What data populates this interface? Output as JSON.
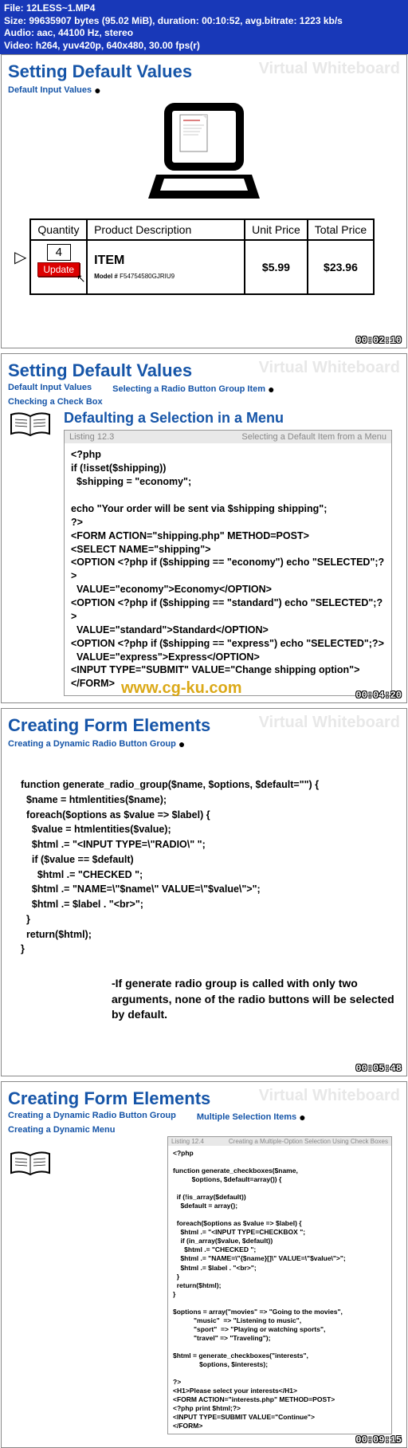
{
  "header": {
    "file": "File: 12LESS~1.MP4",
    "size": "Size: 99635907 bytes (95.02 MiB), duration: 00:10:52, avg.bitrate: 1223 kb/s",
    "audio": "Audio: aac, 44100 Hz, stereo",
    "video": "Video: h264, yuv420p, 640x480, 30.00 fps(r)"
  },
  "slide1": {
    "title": "Setting Default Values",
    "watermark": "Virtual Whiteboard",
    "crumb": "Default Input Values",
    "table": {
      "h1": "Quantity",
      "h2": "Product Description",
      "h3": "Unit Price",
      "h4": "Total Price",
      "qty": "4",
      "update": "Update",
      "item": "ITEM",
      "model": "Model #",
      "modelnum": "F54754580GJRIU9",
      "unit": "$5.99",
      "total": "$23.96"
    },
    "ts": "00:02:10"
  },
  "slide2": {
    "title": "Setting Default Values",
    "watermark": "Virtual Whiteboard",
    "crumb1": "Default Input Values",
    "crumb2": "Selecting a Radio Button Group Item",
    "crumb3": "Checking a Check Box",
    "section": "Defaulting a Selection in a Menu",
    "listing_no": "Listing 12.3",
    "listing_title": "Selecting a Default Item from a Menu",
    "code": "<?php\nif (!isset($shipping))\n  $shipping = \"economy\";\n\necho \"Your order will be sent via $shipping shipping\";\n?>\n<FORM ACTION=\"shipping.php\" METHOD=POST>\n<SELECT NAME=\"shipping\">\n<OPTION <?php if ($shipping == \"economy\") echo \"SELECTED\";?>\n  VALUE=\"economy\">Economy</OPTION>\n<OPTION <?php if ($shipping == \"standard\") echo \"SELECTED\";?>\n  VALUE=\"standard\">Standard</OPTION>\n<OPTION <?php if ($shipping == \"express\") echo \"SELECTED\";?>\n  VALUE=\"express\">Express</OPTION>\n<INPUT TYPE=\"SUBMIT\" VALUE=\"Change shipping option\">\n</FORM>",
    "cgku": "www.cg-ku.com",
    "ts": "00:04:20"
  },
  "slide3": {
    "title": "Creating Form Elements",
    "watermark": "Virtual Whiteboard",
    "crumb": "Creating a Dynamic Radio Button Group",
    "code": "function generate_radio_group($name, $options, $default=\"\") {\n  $name = htmlentities($name);\n  foreach($options as $value => $label) {\n    $value = htmlentities($value);\n    $html .= \"<INPUT TYPE=\\\"RADIO\\\" \";\n    if ($value == $default)\n      $html .= \"CHECKED \";\n    $html .= \"NAME=\\\"$name\\\" VALUE=\\\"$value\\\">\";\n    $html .= $label . \"<br>\";\n  }\n  return($html);\n}",
    "note": "-If generate radio group is called with only two arguments, none of the radio buttons will be selected by default.",
    "ts": "00:05:48"
  },
  "slide4": {
    "title": "Creating Form Elements",
    "watermark": "Virtual Whiteboard",
    "crumb1": "Creating a Dynamic Radio Button Group",
    "crumb2": "Multiple Selection Items",
    "crumb3": "Creating a Dynamic Menu",
    "listing_no": "Listing 12.4",
    "listing_title": "Creating a Multiple-Option Selection Using Check Boxes",
    "code": "<?php\n\nfunction generate_checkboxes($name,\n          $options, $default=array()) {\n\n  if (!is_array($default))\n    $default = array();\n\n  foreach($options as $value => $label) {\n    $html .= \"<INPUT TYPE=CHECKBOX \";\n    if (in_array($value, $default))\n      $html .= \"CHECKED \";\n    $html .= \"NAME=\\\"{$name}[]\\\" VALUE=\\\"$value\\\">\";\n    $html .= $label . \"<br>\";\n  }\n  return($html);\n}\n\n$options = array(\"movies\" => \"Going to the movies\",\n           \"music\"  => \"Listening to music\",\n           \"sport\"  => \"Playing or watching sports\",\n           \"travel\" => \"Traveling\");\n\n$html = generate_checkboxes(\"interests\",\n              $options, $interests);\n\n?>\n<H1>Please select your interests</H1>\n<FORM ACTION=\"interests.php\" METHOD=POST>\n<?php print $html;?>\n<INPUT TYPE=SUBMIT VALUE=\"Continue\">\n</FORM>",
    "ts": "00:09:15"
  }
}
